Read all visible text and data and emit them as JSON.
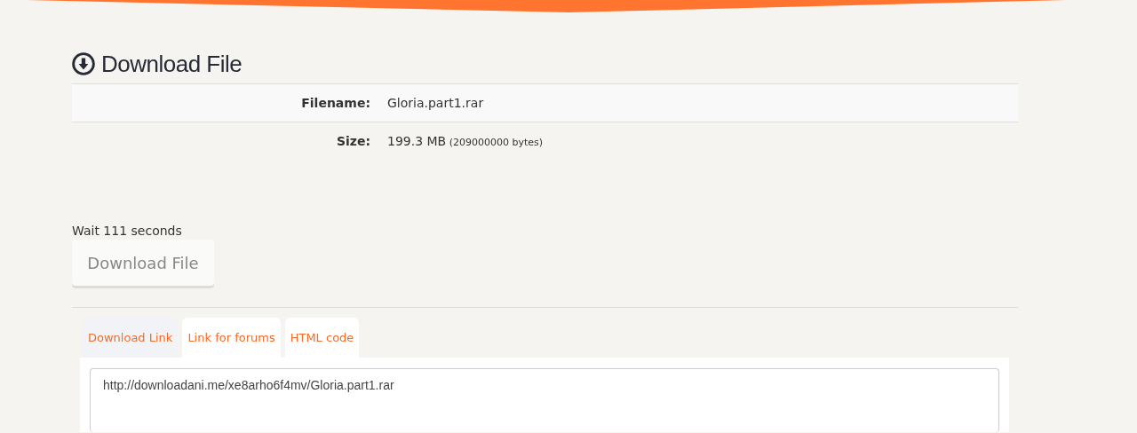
{
  "heading": {
    "title": "Download File"
  },
  "details": [
    {
      "label": "Filename:",
      "value": "Gloria.part1.rar"
    },
    {
      "label": "Size:",
      "value": "199.3 MB",
      "note": "(209000000 bytes)"
    }
  ],
  "wait_message": "Wait 111 seconds",
  "download_button": {
    "label": "Download File",
    "disabled": true
  },
  "tabs": [
    {
      "label": "Download Link",
      "selected": true
    },
    {
      "label": "Link for forums",
      "selected": false
    },
    {
      "label": "HTML code",
      "selected": false
    }
  ],
  "link_box": {
    "value": "http://downloadani.me/xe8arho6f4mv/Gloria.part1.rar"
  }
}
